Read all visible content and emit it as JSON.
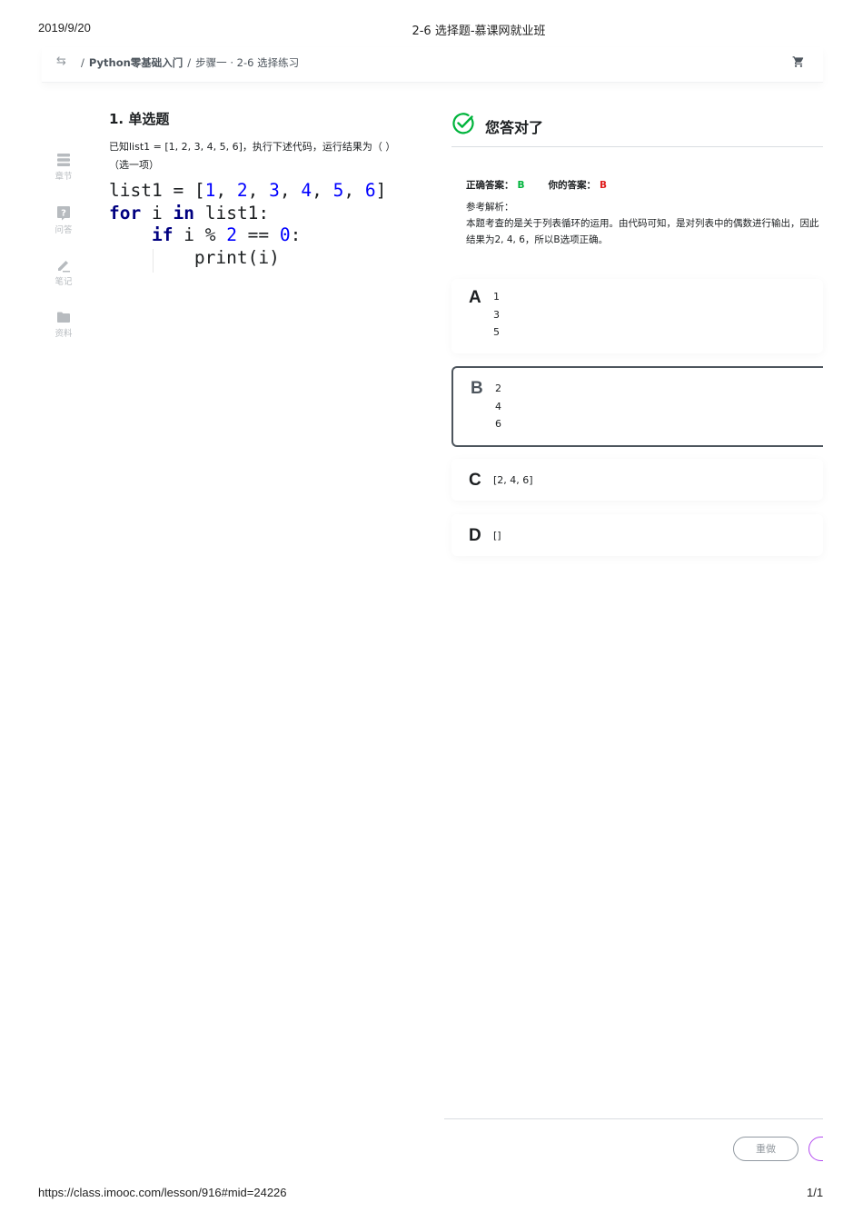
{
  "print": {
    "date": "2019/9/20",
    "title": "2-6 选择题-慕课网就业班",
    "url": "https://class.imooc.com/lesson/916#mid=24226",
    "page": "1/1"
  },
  "topbar": {
    "course": "Python零基础入门",
    "lesson": "步骤一 · 2-6 选择练习",
    "separator": "/",
    "back_icon": "swap-arrows-icon",
    "cart_icon": "cart-icon"
  },
  "rail": {
    "items": [
      {
        "label": "章节",
        "icon": "chapters-icon"
      },
      {
        "label": "问答",
        "icon": "question-icon"
      },
      {
        "label": "笔记",
        "icon": "pencil-icon"
      },
      {
        "label": "资料",
        "icon": "folder-icon"
      }
    ]
  },
  "question": {
    "title": "1. 单选题",
    "text": "已知list1 = [1, 2, 3, 4, 5, 6]，执行下述代码，运行结果为（ ）（选一项）",
    "code_lines": [
      "list1 = [1, 2, 3, 4, 5, 6]",
      "for i in list1:",
      "    if i % 2 == 0:",
      "        print(i)"
    ]
  },
  "result": {
    "title": "您答对了",
    "correct_label": "正确答案：",
    "correct_value": "B",
    "mine_label": "你的答案：",
    "mine_value": "B",
    "explain_label": "参考解析：",
    "explain_text": "本题考查的是关于列表循环的运用。由代码可知，是对列表中的偶数进行输出，因此结果为2, 4, 6，所以B选项正确。",
    "colors": {
      "correct": "#00b43c",
      "mine": "#e02020",
      "check": "#00b43c"
    }
  },
  "options": [
    {
      "letter": "A",
      "lines": [
        "1",
        "3",
        "5"
      ],
      "selected": false
    },
    {
      "letter": "B",
      "lines": [
        "2",
        "4",
        "6"
      ],
      "selected": true
    },
    {
      "letter": "C",
      "lines": [
        "[2, 4, 6]"
      ],
      "selected": false
    },
    {
      "letter": "D",
      "lines": [
        "[]"
      ],
      "selected": false
    }
  ],
  "actions": {
    "redo_label": "重做",
    "next_label": ""
  }
}
